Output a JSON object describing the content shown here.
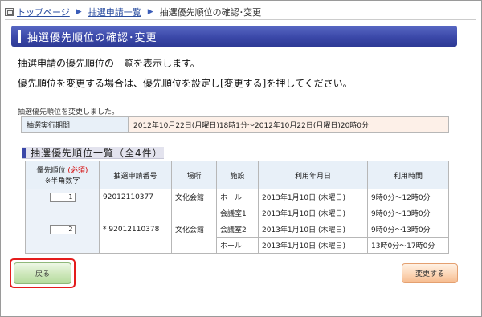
{
  "breadcrumb": {
    "home": "トップページ",
    "list": "抽選申請一覧",
    "current": "抽選優先順位の確認･変更",
    "separator": "▶"
  },
  "page_title": "抽選優先順位の確認･変更",
  "description": {
    "line1": "抽選申請の優先順位の一覧を表示します。",
    "line2": "優先順位を変更する場合は、優先順位を設定し[変更する]を押してください。"
  },
  "status_message": "抽選優先順位を変更しました。",
  "period": {
    "label": "抽選実行期間",
    "value": "2012年10月22日(月曜日)18時1分～2012年10月22日(月曜日)20時0分"
  },
  "section_title": "抽選優先順位一覧（全4件）",
  "table": {
    "headers": {
      "priority": "優先順位",
      "required": "(必須)",
      "priority_note": "※半角数字",
      "request_no": "抽選申請番号",
      "place": "場所",
      "facility": "施設",
      "date": "利用年月日",
      "time": "利用時間"
    },
    "groups": [
      {
        "priority": "1",
        "request_no": "92012110377",
        "place": "文化会館",
        "rows": [
          {
            "facility": "ホール",
            "date": "2013年1月10日 (木曜日)",
            "time": "9時0分～12時0分"
          }
        ]
      },
      {
        "priority": "2",
        "request_no": "* 92012110378",
        "place": "文化会館",
        "rows": [
          {
            "facility": "会議室1",
            "date": "2013年1月10日 (木曜日)",
            "time": "9時0分～13時0分"
          },
          {
            "facility": "会議室2",
            "date": "2013年1月10日 (木曜日)",
            "time": "9時0分～13時0分"
          },
          {
            "facility": "ホール",
            "date": "2013年1月10日 (木曜日)",
            "time": "13時0分～17時0分"
          }
        ]
      }
    ]
  },
  "buttons": {
    "back": "戻る",
    "change": "変更する"
  },
  "colors": {
    "title_bar": "#3b48a8",
    "highlight": "#e41c1c",
    "back_button": "#cfe8bd",
    "change_button": "#fcd6b6",
    "required": "#d40000"
  }
}
